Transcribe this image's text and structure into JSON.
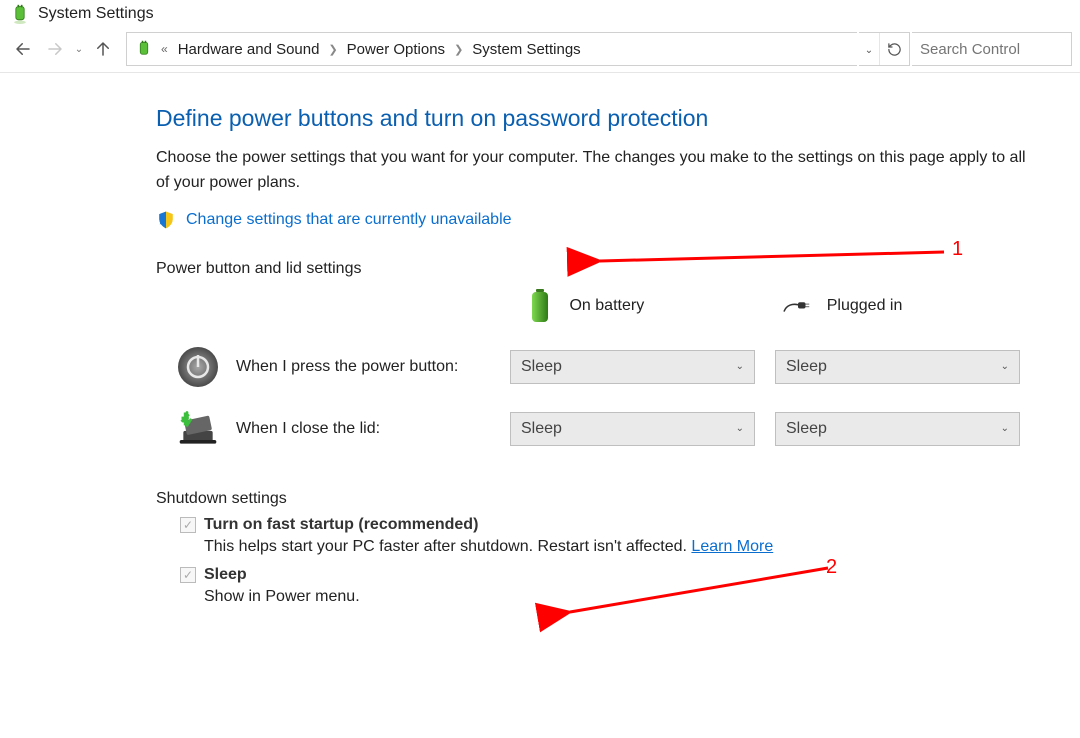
{
  "window": {
    "title": "System Settings"
  },
  "breadcrumb": {
    "items": [
      "Hardware and Sound",
      "Power Options",
      "System Settings"
    ]
  },
  "search": {
    "placeholder": "Search Control"
  },
  "page": {
    "title": "Define power buttons and turn on password protection",
    "description": "Choose the power settings that you want for your computer. The changes you make to the settings on this page apply to all of your power plans.",
    "change_link": "Change settings that are currently unavailable"
  },
  "sections": {
    "power_button": {
      "header": "Power button and lid settings",
      "col_battery": "On battery",
      "col_plugged": "Plugged in",
      "rows": [
        {
          "label": "When I press the power button:",
          "battery": "Sleep",
          "plugged": "Sleep"
        },
        {
          "label": "When I close the lid:",
          "battery": "Sleep",
          "plugged": "Sleep"
        }
      ]
    },
    "shutdown": {
      "header": "Shutdown settings",
      "fast_startup": {
        "label": "Turn on fast startup (recommended)",
        "desc_prefix": "This helps start your PC faster after shutdown. Restart isn't affected. ",
        "learn_more": "Learn More"
      },
      "sleep": {
        "label": "Sleep",
        "desc": "Show in Power menu."
      }
    }
  },
  "annotations": {
    "one": "1",
    "two": "2"
  }
}
